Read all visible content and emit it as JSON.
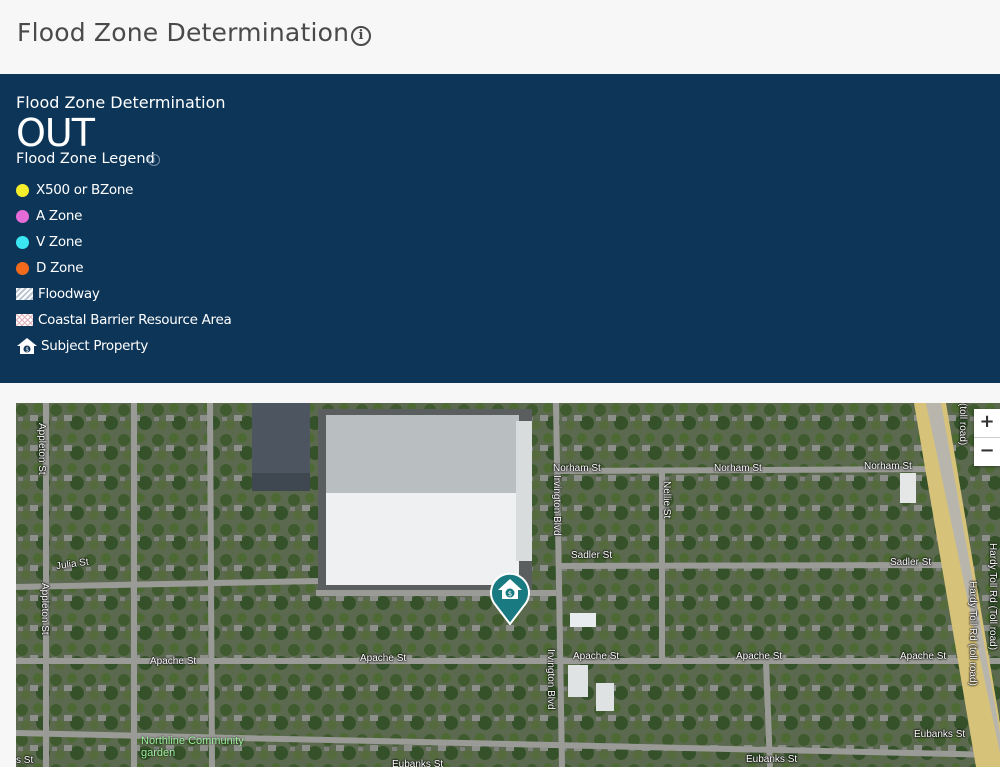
{
  "header": {
    "title": "Flood Zone Determination",
    "info_icon": "info-icon"
  },
  "panel": {
    "title": "Flood Zone Determination",
    "determination": "OUT",
    "legend_title": "Flood Zone Legend",
    "legend": [
      {
        "label": "X500 or BZone",
        "color": "#f5ee2c",
        "icon": "dot"
      },
      {
        "label": "A Zone",
        "color": "#e56bd8",
        "icon": "dot"
      },
      {
        "label": "V Zone",
        "color": "#39e6f2",
        "icon": "dot"
      },
      {
        "label": "D Zone",
        "color": "#f26a1b",
        "icon": "dot"
      },
      {
        "label": "Floodway",
        "icon": "hatch"
      },
      {
        "label": "Coastal Barrier Resource Area",
        "icon": "cross-hatch"
      },
      {
        "label": "Subject Property",
        "icon": "house-dollar-icon"
      }
    ]
  },
  "map": {
    "zoom_in": "+",
    "zoom_out": "−",
    "streets": {
      "appleton_top": "Appleton St",
      "appleton_bottom": "Appleton St",
      "julia": "Julia St",
      "norham_1": "Norham St",
      "norham_2": "Norham St",
      "norham_3": "Norham St",
      "irvington_top": "Irvington Blvd",
      "irvington_bottom": "Irvington Blvd",
      "nellie": "Nellie St",
      "sadler_1": "Sadler St",
      "sadler_2": "Sadler St",
      "apache_1": "Apache St",
      "apache_2": "Apache St",
      "apache_3": "Apache St",
      "apache_4": "Apache St",
      "apache_5": "Apache St",
      "eubanks_1": "Eubanks St",
      "eubanks_2": "Eubanks St",
      "eubanks_3": "Eubanks St",
      "hardy_1": "Hardy Toll Rd (Toll road)",
      "hardy_2": "Hardy Toll Rd (toll road)",
      "toll_top": "(toll road)",
      "s_st": "s St"
    },
    "poi": "Northline Community garden",
    "colors": {
      "panel": "#0d3558",
      "pin": "#1a7a82"
    }
  }
}
